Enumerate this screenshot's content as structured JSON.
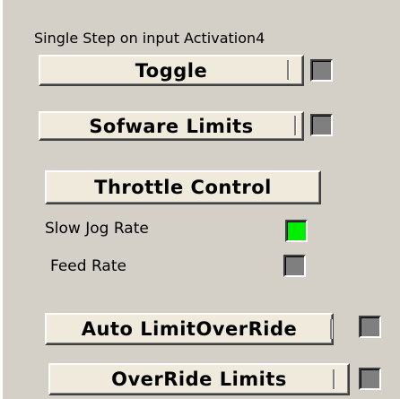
{
  "header": {
    "title": "Single Step on input Activation4"
  },
  "buttons": {
    "toggle": "Toggle",
    "software_limits": "Sofware Limits",
    "throttle_control": "Throttle Control",
    "auto_limit_override": "Auto LimitOverRide",
    "override_limits": "OverRide Limits"
  },
  "labels": {
    "slow_jog_rate": "Slow Jog Rate",
    "feed_rate": "Feed Rate"
  },
  "leds": {
    "toggle": {
      "state": "off",
      "color": "#7f7f7f"
    },
    "software_limits": {
      "state": "off",
      "color": "#7f7f7f"
    },
    "slow_jog_rate": {
      "state": "on",
      "color": "#00ee00"
    },
    "feed_rate": {
      "state": "off",
      "color": "#7f7f7f"
    },
    "auto_limit_override": {
      "state": "off",
      "color": "#7f7f7f"
    },
    "override_limits": {
      "state": "off",
      "color": "#7f7f7f"
    }
  },
  "colors": {
    "panel_background": "#d4d0c8",
    "button_face": "#efeadc",
    "led_off": "#7f7f7f",
    "led_on": "#00ee00"
  }
}
